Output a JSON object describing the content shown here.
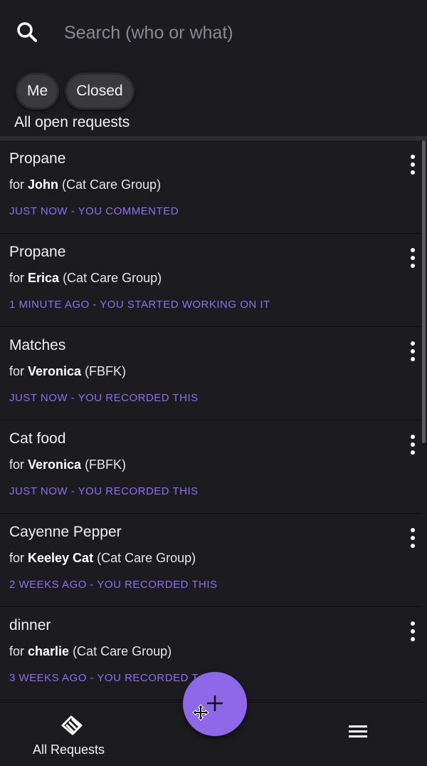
{
  "search": {
    "placeholder": "Search (who or what)",
    "icon": "search-icon"
  },
  "filters": {
    "chips": [
      "Me",
      "Closed"
    ],
    "label": "All open requests"
  },
  "requests": [
    {
      "title": "Propane",
      "prefix": "for ",
      "person": "John",
      "group": " (Cat Care Group)",
      "status": "JUST NOW - YOU COMMENTED"
    },
    {
      "title": "Propane",
      "prefix": "for ",
      "person": "Erica",
      "group": " (Cat Care Group)",
      "status": "1 MINUTE AGO - YOU STARTED WORKING ON IT"
    },
    {
      "title": "Matches",
      "prefix": "for ",
      "person": "Veronica",
      "group": " (FBFK)",
      "status": "JUST NOW - YOU RECORDED THIS"
    },
    {
      "title": "Cat food",
      "prefix": "for ",
      "person": "Veronica",
      "group": " (FBFK)",
      "status": "JUST NOW - YOU RECORDED THIS"
    },
    {
      "title": "Cayenne Pepper",
      "prefix": "for ",
      "person": "Keeley Cat",
      "group": " (Cat Care Group)",
      "status": "2 WEEKS AGO - YOU RECORDED THIS"
    },
    {
      "title": "dinner",
      "prefix": "for ",
      "person": "charlie",
      "group": " (Cat Care Group)",
      "status": "3 WEEKS AGO - YOU RECORDED T"
    }
  ],
  "nav": {
    "all_requests_label": "All Requests",
    "all_requests_icon": "handshake-icon",
    "menu_icon": "hamburger-menu-icon"
  },
  "fab": {
    "icon": "plus-icon"
  },
  "colors": {
    "background": "#1c1b20",
    "accent": "#8e68e8",
    "status": "#8f6ff0"
  }
}
